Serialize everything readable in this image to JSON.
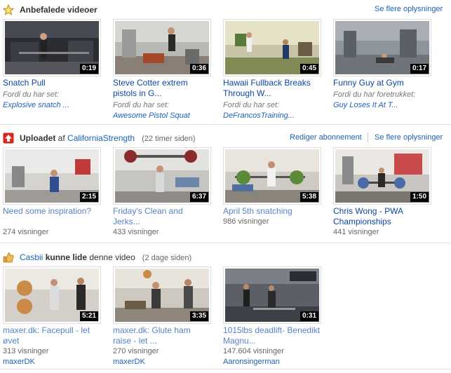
{
  "sections": {
    "recommended": {
      "title": "Anbefalede videoer",
      "more_link": "Se flere oplysninger",
      "videos": [
        {
          "title": "Snatch Pull",
          "duration": "0:19",
          "reason": "Fordi du har set:",
          "source": "Explosive snatch ..."
        },
        {
          "title": "Steve Cotter extrem pistols in G...",
          "duration": "0:36",
          "reason": "Fordi du har set:",
          "source": "Awesome Pistol Squat"
        },
        {
          "title": "Hawaii Fullback Breaks Through W...",
          "duration": "0:45",
          "reason": "Fordi du har set:",
          "source": "DeFrancosTraining..."
        },
        {
          "title": "Funny Guy at Gym",
          "duration": "0:17",
          "reason": "Fordi du har foretrukket:",
          "source": "Guy Loses It At T..."
        }
      ]
    },
    "uploads": {
      "title_bold": "Uploadet",
      "title_mid": " af ",
      "channel": "CaliforniaStrength",
      "time": "(22 timer siden)",
      "edit_link": "Rediger abonnement",
      "more_link": "Se flere oplysninger",
      "videos": [
        {
          "title": "Need some inspiration?",
          "duration": "2:15",
          "views": "274 visninger"
        },
        {
          "title": "Friday's Clean and Jerks...",
          "duration": "6:37",
          "views": "433 visninger"
        },
        {
          "title": "April 5th snatching",
          "duration": "5:38",
          "views": "986 visninger"
        },
        {
          "title": "Chris Wong - PWA Championships",
          "duration": "1:50",
          "views": "441 visninger"
        }
      ]
    },
    "liked": {
      "user": "Casbii",
      "title_bold": " kunne lide",
      "title_rest": " denne video",
      "time": "(2 dage siden)",
      "videos": [
        {
          "title": "maxer.dk: Facepull - let øvet",
          "duration": "5:21",
          "views": "313 visninger",
          "uploader": "maxerDK"
        },
        {
          "title": "maxer.dk: Glute ham raise - let ...",
          "duration": "3:35",
          "views": "270 visninger",
          "uploader": "maxerDK"
        },
        {
          "title": "1015lbs deadlift- Benedikt Magnu...",
          "duration": "0:31",
          "views": "147.604 visninger",
          "uploader": "Aaronsingerman"
        }
      ]
    }
  },
  "colors": {
    "link": "#1c62b9",
    "title_dark": "#0d47a1",
    "title_light": "#5583c7",
    "divider": "#e2e2e2",
    "upload_icon": "#d9261c",
    "star_icon": "#f4c430",
    "like_icon": "#e8a33a"
  },
  "icons": {
    "recommended": "star-icon",
    "uploads": "upload-arrow-icon",
    "liked": "thumbs-up-icon"
  }
}
